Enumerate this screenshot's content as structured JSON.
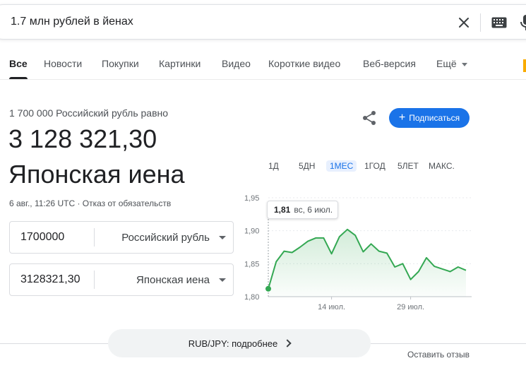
{
  "search": {
    "query": "1.7 млн рублей в йенах"
  },
  "tabs": [
    {
      "label": "Все"
    },
    {
      "label": "Новости"
    },
    {
      "label": "Покупки"
    },
    {
      "label": "Картинки"
    },
    {
      "label": "Видео"
    },
    {
      "label": "Короткие видео"
    },
    {
      "label": "Веб-версия"
    },
    {
      "label": "Ещё"
    }
  ],
  "result": {
    "equals_label": "1 700 000 Российский рубль равно",
    "value": "3 128 321,30",
    "currency": "Японская иена",
    "timestamp": "6 авг., 11:26 UTC",
    "separator": " · ",
    "disclaimer": "Отказ от обязательств",
    "subscribe_label": "Подписаться"
  },
  "converter": {
    "from_amount": "1700000",
    "from_currency": "Российский рубль",
    "to_amount": "3128321,30",
    "to_currency": "Японская иена"
  },
  "ranges": [
    {
      "label": "1Д"
    },
    {
      "label": "5ДН"
    },
    {
      "label": "1МЕС",
      "active": true
    },
    {
      "label": "1ГОД"
    },
    {
      "label": "5ЛЕТ"
    },
    {
      "label": "МАКС."
    }
  ],
  "tooltip": {
    "value": "1,81",
    "date": "вс, 6 июл."
  },
  "chart_data": {
    "type": "line",
    "x_labels": [
      "14 июл.",
      "29 июл."
    ],
    "y_ticks": [
      "1,95",
      "1,90",
      "1,85",
      "1,80"
    ],
    "ylim": [
      1.8,
      1.95
    ],
    "series": [
      {
        "values": [
          1.812,
          1.853,
          1.869,
          1.867,
          1.875,
          1.884,
          1.889,
          1.889,
          1.865,
          1.891,
          1.902,
          1.893,
          1.868,
          1.88,
          1.869,
          1.866,
          1.845,
          1.85,
          1.826,
          1.838,
          1.859,
          1.846,
          1.842,
          1.838,
          1.845,
          1.84
        ]
      }
    ],
    "color": "#34a853"
  },
  "footer": {
    "more_label": "RUB/JPY: подробнее",
    "feedback_label": "Оставить отзыв"
  }
}
